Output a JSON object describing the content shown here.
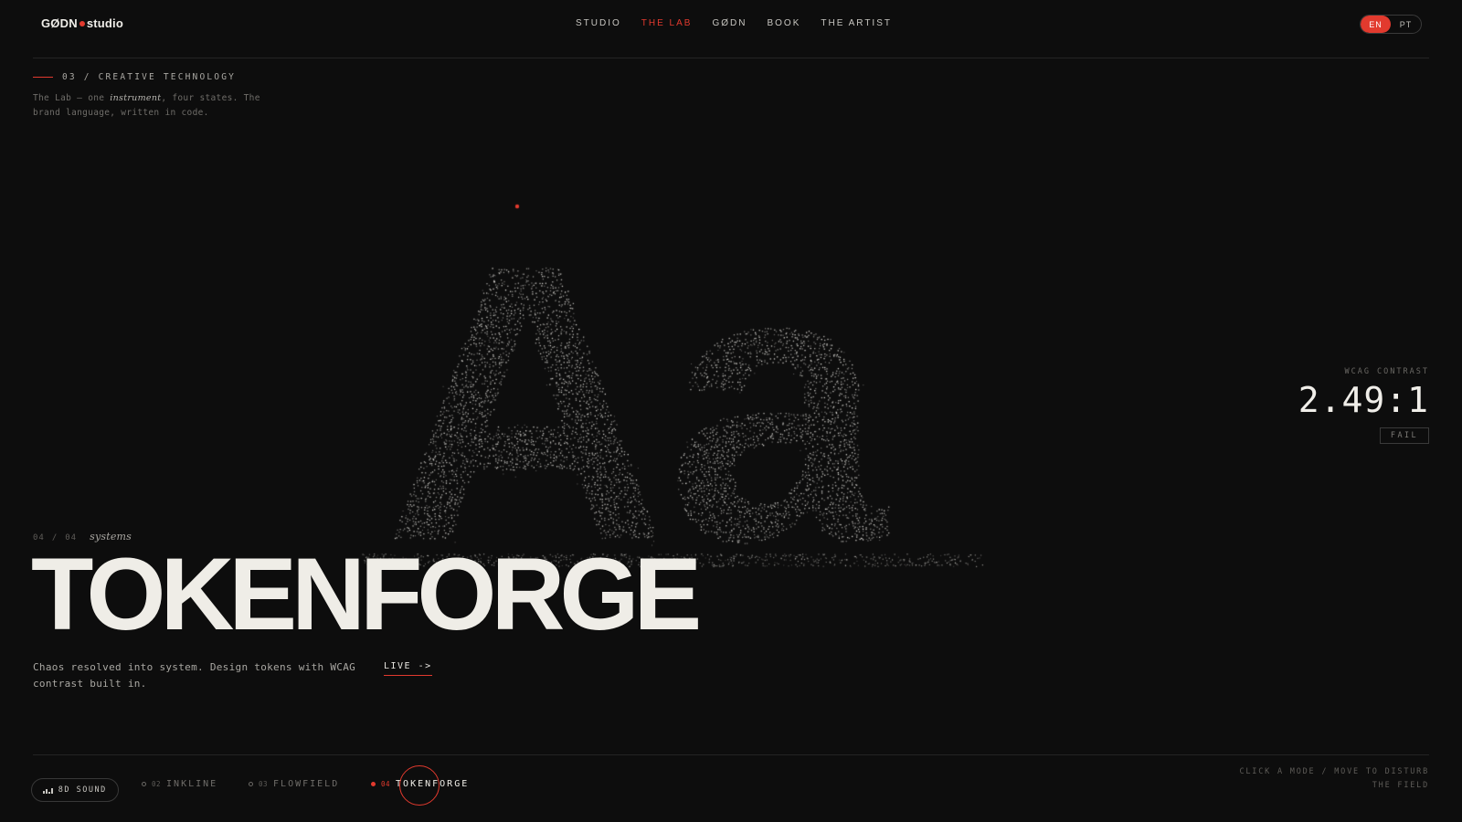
{
  "header": {
    "logo_left": "GØDN",
    "logo_right": "studio",
    "nav": [
      {
        "label": "STUDIO",
        "active": false
      },
      {
        "label": "THE LAB",
        "active": true
      },
      {
        "label": "GØDN",
        "active": false
      },
      {
        "label": "BOOK",
        "active": false
      },
      {
        "label": "THE ARTIST",
        "active": false
      }
    ],
    "lang": {
      "en": "EN",
      "pt": "PT",
      "selected": "EN"
    }
  },
  "section": {
    "tag": "03 / CREATIVE TECHNOLOGY",
    "intro_before": "The Lab — one ",
    "intro_em": "instrument",
    "intro_after": ", four states. The brand language, written in code."
  },
  "specimen": {
    "glyphs": "Aa"
  },
  "wcag": {
    "label": "WCAG CONTRAST",
    "value": "2.49:1",
    "status": "FAIL"
  },
  "project": {
    "index": "04",
    "total": "04",
    "category": "systems",
    "title": "TOKENFORGE",
    "description": "Chaos resolved into system. Design tokens with WCAG contrast built in.",
    "live_label": "LIVE ->"
  },
  "footer": {
    "sound_label": "8D SOUND",
    "modes": [
      {
        "num": "02",
        "label": "INKLINE",
        "active": false
      },
      {
        "num": "03",
        "label": "FLOWFIELD",
        "active": false
      },
      {
        "num": "04",
        "label": "TOKENFORGE",
        "active": true
      }
    ],
    "hint_line1": "CLICK A MODE / MOVE TO DISTURB",
    "hint_line2": "THE FIELD"
  },
  "colors": {
    "accent": "#e23a2e",
    "background": "#0d0d0d",
    "text": "#efede7"
  }
}
